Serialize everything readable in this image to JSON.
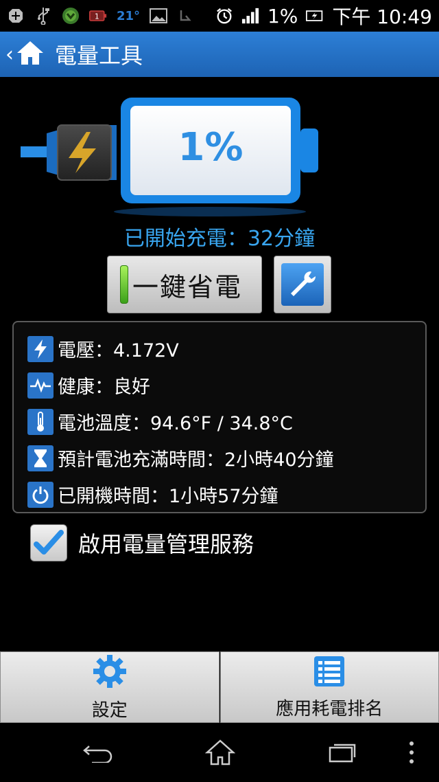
{
  "status_bar": {
    "temperature": "21°",
    "battery_percent": "1%",
    "time": "下午 10:49",
    "icons": [
      "add-icon",
      "usb-icon",
      "shield-icon",
      "battery-alert-icon",
      "image-icon",
      "bluetooth-icon",
      "alarm-icon",
      "signal-icon",
      "battery-charging-icon"
    ]
  },
  "action_bar": {
    "title": "電量工具",
    "icons": [
      "back-chevron-icon",
      "home-icon"
    ]
  },
  "battery": {
    "percent_label": "1%",
    "level": 0.01,
    "charging_status": "已開始充電：32分鐘"
  },
  "buttons": {
    "one_key_save": "一鍵省電",
    "tools_icon": "wrench-icon"
  },
  "info": [
    {
      "icon": "lightning-icon",
      "label": "電壓：4.172V"
    },
    {
      "icon": "pulse-icon",
      "label": "健康：良好"
    },
    {
      "icon": "thermometer-icon",
      "label": "電池溫度：94.6°F / 34.8°C"
    },
    {
      "icon": "hourglass-icon",
      "label": "預計電池充滿時間：2小時40分鐘"
    },
    {
      "icon": "power-icon",
      "label": "已開機時間：1小時57分鐘"
    }
  ],
  "service": {
    "label": "啟用電量管理服務",
    "checked": true
  },
  "tabs": [
    {
      "icon": "gear-icon",
      "label": "設定"
    },
    {
      "icon": "list-icon",
      "label": "應用耗電排名"
    }
  ],
  "colors": {
    "accent": "#2a74c8",
    "action_bar": "#2268bc",
    "charge_text": "#39a6f0",
    "battery_outline": "#2a8ee6"
  }
}
